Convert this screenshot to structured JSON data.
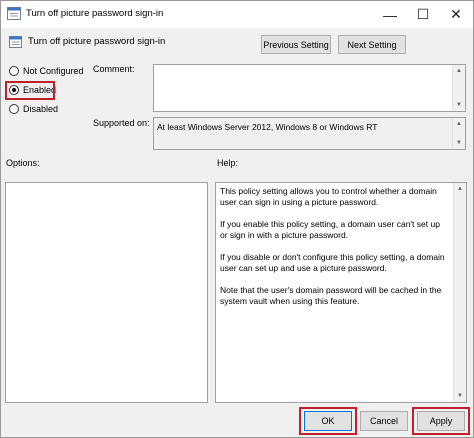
{
  "window": {
    "title": "Turn off picture password sign-in",
    "minimize_glyph": "—",
    "maximize_glyph": "☐",
    "close_glyph": "✕"
  },
  "header": {
    "policy_name": "Turn off picture password sign-in",
    "previous_label": "Previous Setting",
    "next_label": "Next Setting"
  },
  "state": {
    "options": [
      {
        "label": "Not Configured",
        "selected": false
      },
      {
        "label": "Enabled",
        "selected": true
      },
      {
        "label": "Disabled",
        "selected": false
      }
    ]
  },
  "comment": {
    "label": "Comment:",
    "value": ""
  },
  "supported": {
    "label": "Supported on:",
    "value": "At least Windows Server 2012, Windows 8 or Windows RT"
  },
  "options_panel": {
    "label": "Options:"
  },
  "help_panel": {
    "label": "Help:",
    "paragraphs": [
      "This policy setting allows you to control whether a domain user can sign in using a picture password.",
      "If you enable this policy setting, a domain user can't set up or sign in with a picture password.",
      "If you disable or don't configure this policy setting, a domain user can set up and use a picture password.",
      "Note that the user's domain password will be cached in the system vault when using this feature."
    ]
  },
  "footer": {
    "ok_label": "OK",
    "cancel_label": "Cancel",
    "apply_label": "Apply"
  },
  "colors": {
    "highlight_box": "#c0202a",
    "default_button_border": "#0078d7",
    "dialog_background": "#f0f0f0"
  },
  "icons": {
    "app": "policy-sheet-icon",
    "policy": "policy-sheet-icon",
    "scroll_up": "arrow-up-icon",
    "scroll_down": "arrow-down-icon"
  }
}
